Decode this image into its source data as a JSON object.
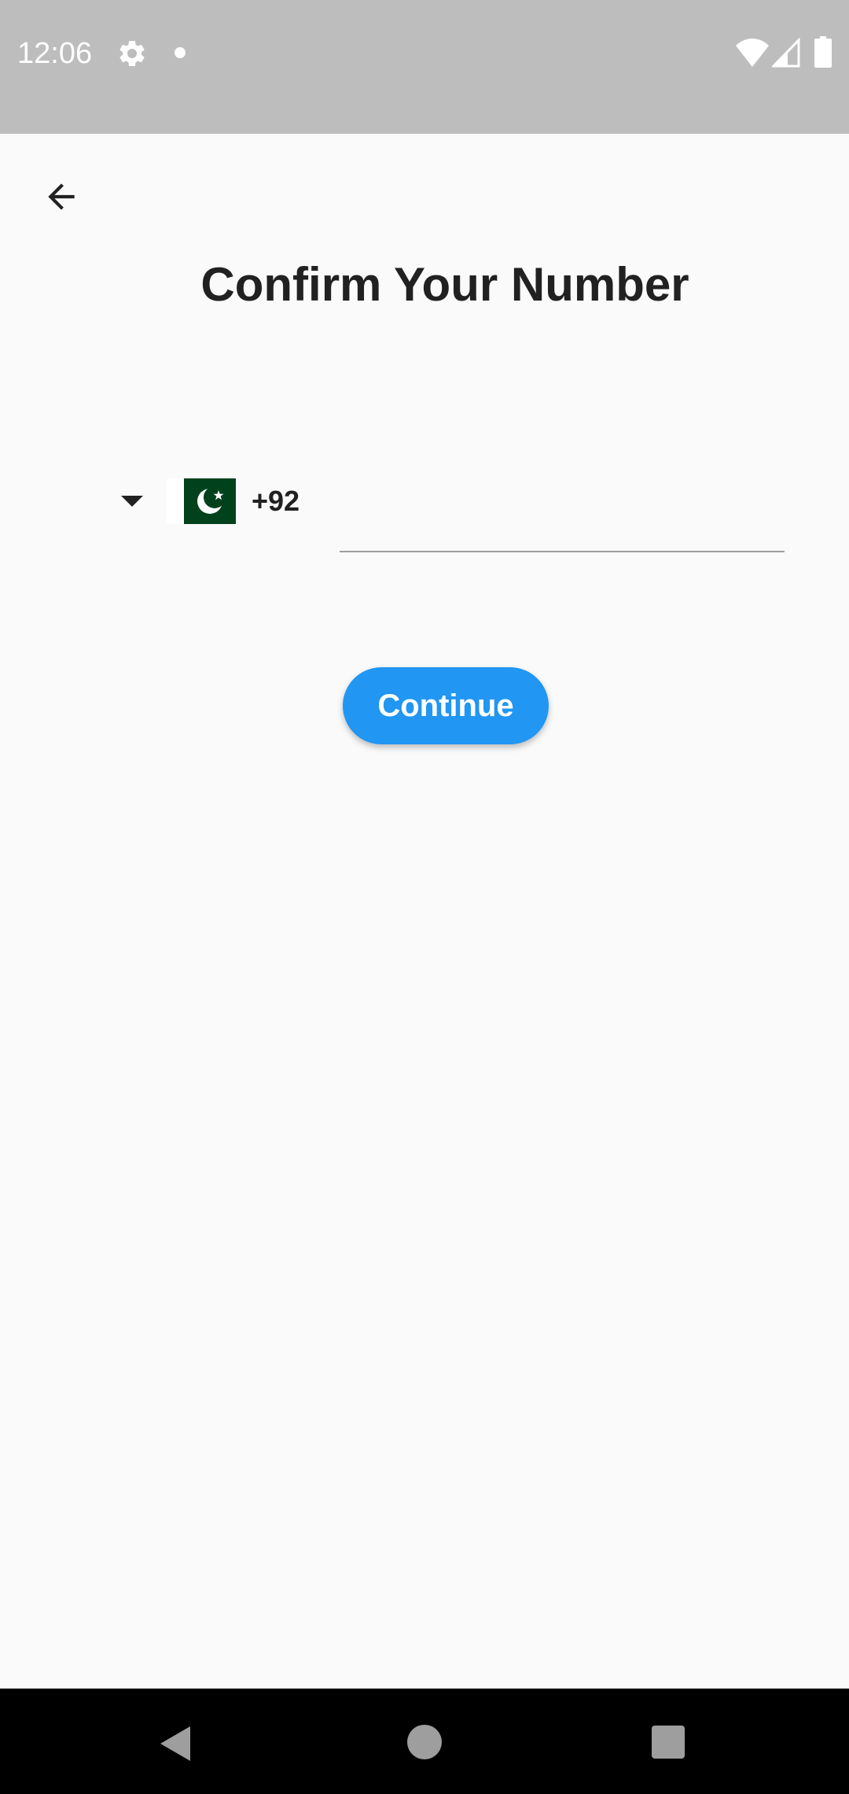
{
  "status_bar": {
    "time": "12:06",
    "icons": [
      "gear-icon",
      "notification-dot-icon",
      "wifi-icon",
      "signal-icon",
      "battery-icon"
    ]
  },
  "toolbar": {
    "back_icon": "arrow-left-icon"
  },
  "page": {
    "title": "Confirm Your Number"
  },
  "phone_form": {
    "country_flag": "pakistan-flag-icon",
    "dial_code": "+92",
    "phone_value": "",
    "continue_label": "Continue"
  },
  "nav_bar": {
    "icons": [
      "back-triangle-icon",
      "home-circle-icon",
      "recents-square-icon"
    ]
  },
  "colors": {
    "accent": "#2196f3",
    "status_bar": "#bdbdbd",
    "background": "#fafafa",
    "flag_green": "#01411c"
  }
}
